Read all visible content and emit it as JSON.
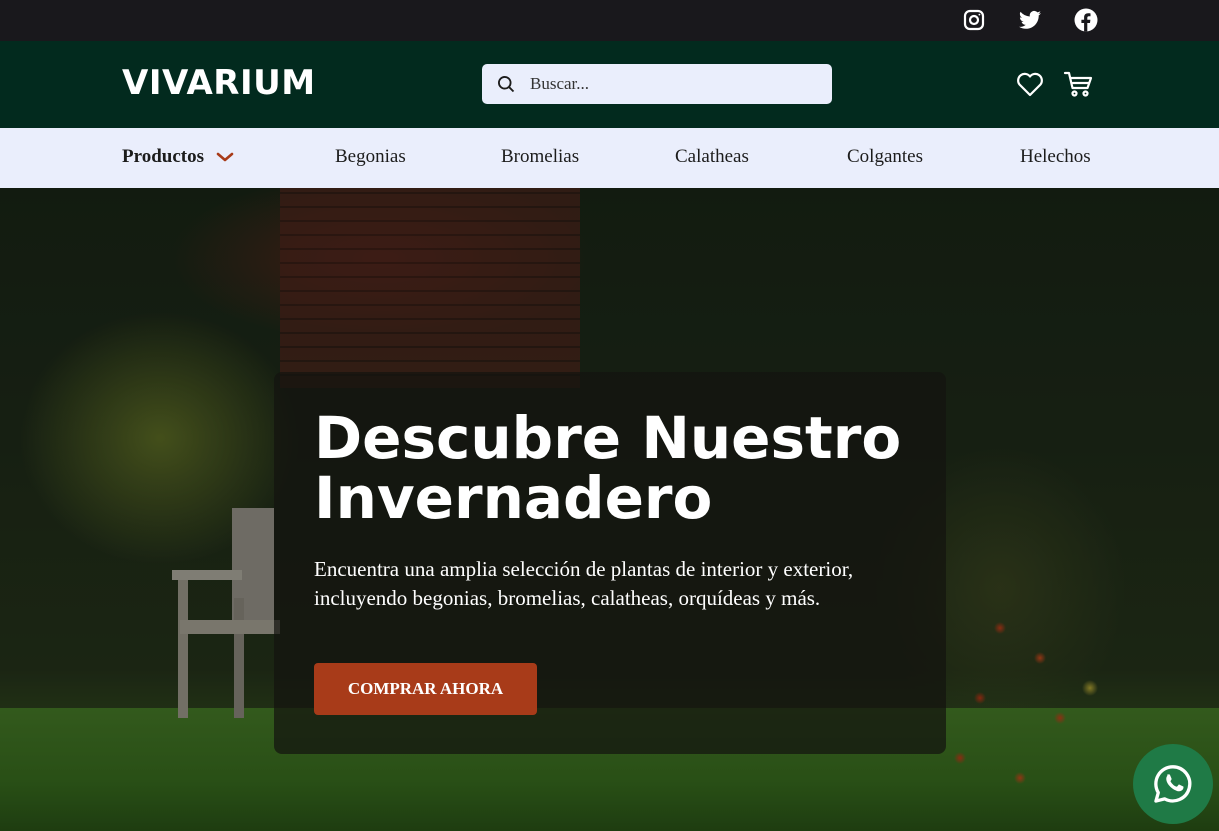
{
  "topbar": {
    "social": [
      {
        "icon": "instagram-icon"
      },
      {
        "icon": "twitter-icon"
      },
      {
        "icon": "facebook-icon"
      }
    ]
  },
  "header": {
    "logo": "VIVARIUM",
    "search": {
      "placeholder": "Buscar...",
      "value": ""
    },
    "icons": [
      "heart-icon",
      "cart-icon"
    ]
  },
  "nav": {
    "items": [
      {
        "label": "Productos",
        "dropdown": true
      },
      {
        "label": "Begonias"
      },
      {
        "label": "Bromelias"
      },
      {
        "label": "Calatheas"
      },
      {
        "label": "Colgantes"
      },
      {
        "label": "Helechos"
      }
    ]
  },
  "hero": {
    "title": "Descubre Nuestro Invernadero",
    "text": "Encuentra una amplia selección de plantas de interior y exterior, incluyendo begonias, bromelias, calatheas, orquídeas y más.",
    "cta_label": "COMPRAR AHORA"
  },
  "colors": {
    "topbar": "#19181c",
    "header": "#022a1e",
    "nav": "#eaeefc",
    "accent": "#a83b19",
    "whatsapp": "#1f7a46"
  }
}
